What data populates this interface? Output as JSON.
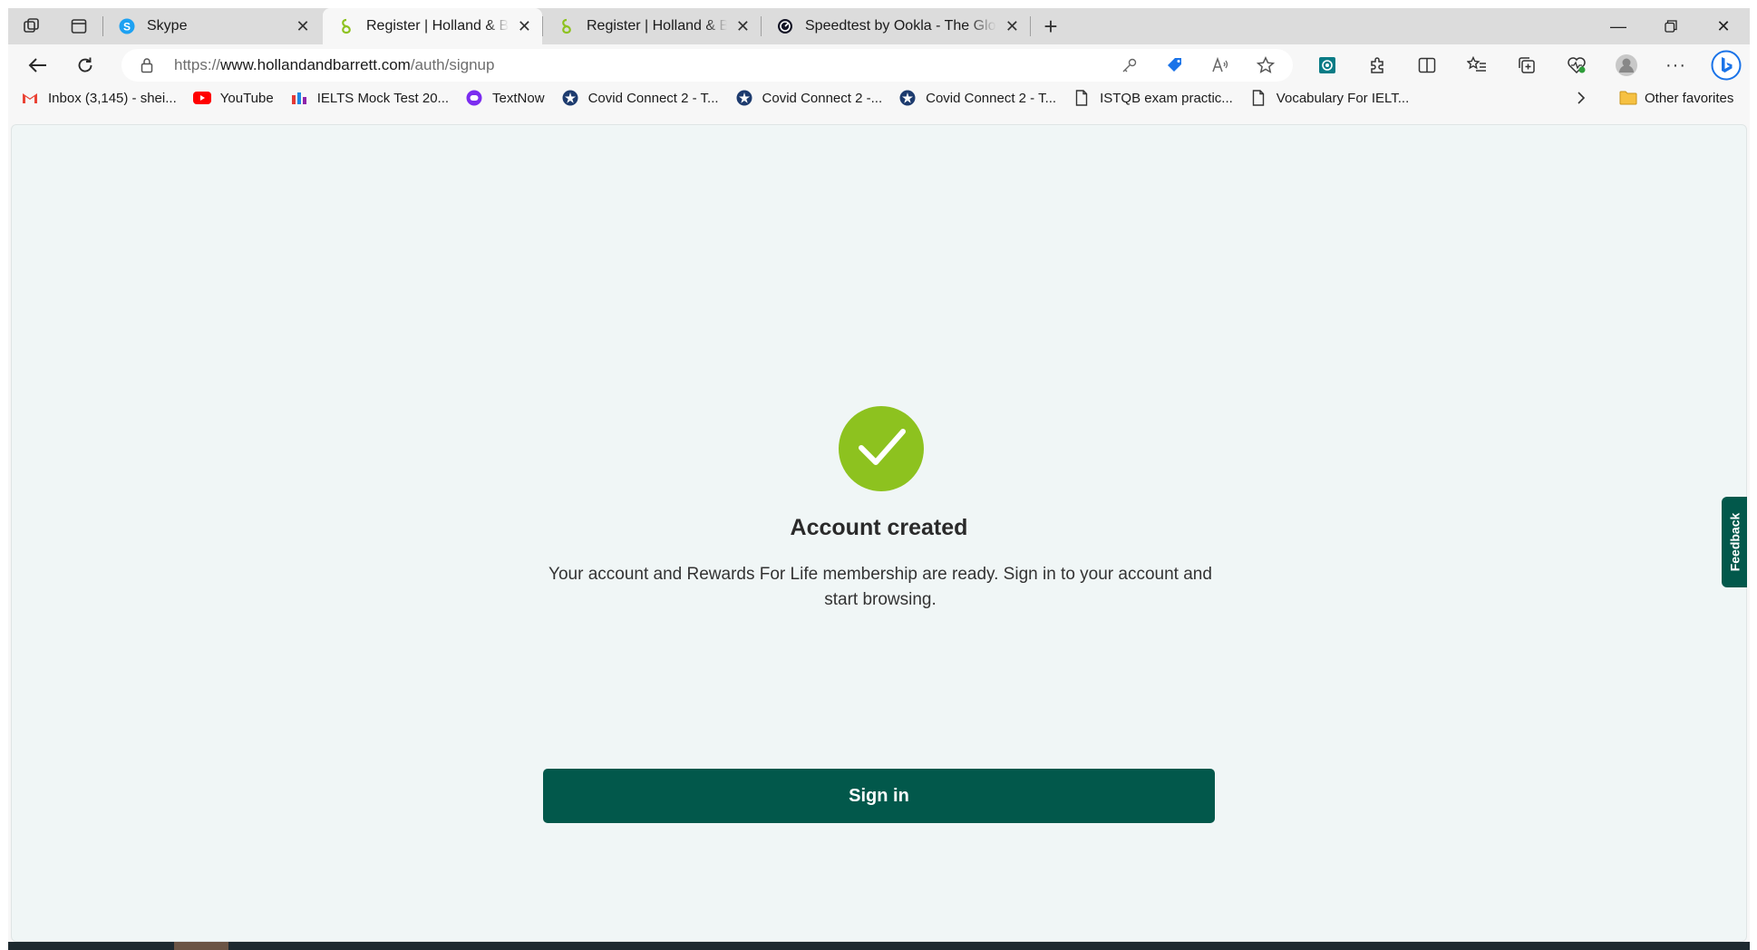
{
  "tabs": [
    {
      "title": "Skype",
      "favicon": "skype-icon",
      "active": false
    },
    {
      "title": "Register | Holland & Barrett - the UK's Leading Health Retailer",
      "favicon": "holland-barrett-icon",
      "active": true
    },
    {
      "title": "Register | Holland & Barrett - the UK's Leading Health Retailer",
      "favicon": "holland-barrett-icon",
      "active": false
    },
    {
      "title": "Speedtest by Ookla - The Global Broadband Speed Test",
      "favicon": "speedtest-icon",
      "active": false
    }
  ],
  "address_bar": {
    "url_prefix": "https://",
    "url_host": "www.hollandandbarrett.com",
    "url_path": "/auth/signup"
  },
  "favorites": [
    {
      "label": "Inbox (3,145) - shei...",
      "icon": "gmail-icon"
    },
    {
      "label": "YouTube",
      "icon": "youtube-icon"
    },
    {
      "label": "IELTS Mock Test 20...",
      "icon": "ielts-icon"
    },
    {
      "label": "TextNow",
      "icon": "textnow-icon"
    },
    {
      "label": "Covid Connect 2 - T...",
      "icon": "covid-connect-icon"
    },
    {
      "label": "Covid Connect 2 -...",
      "icon": "covid-connect-icon"
    },
    {
      "label": "Covid Connect 2 - T...",
      "icon": "covid-connect-icon"
    },
    {
      "label": "ISTQB exam practic...",
      "icon": "page-icon"
    },
    {
      "label": "Vocabulary For IELT...",
      "icon": "page-icon"
    }
  ],
  "favorites_other": "Other favorites",
  "page": {
    "heading": "Account created",
    "message": "Your account and Rewards For Life membership are ready. Sign in to your account and start browsing.",
    "button_label": "Sign in",
    "feedback_label": "Feedback"
  },
  "colors": {
    "success": "#8dc21f",
    "brand": "#02584b",
    "page_bg": "#f0f6f6"
  }
}
